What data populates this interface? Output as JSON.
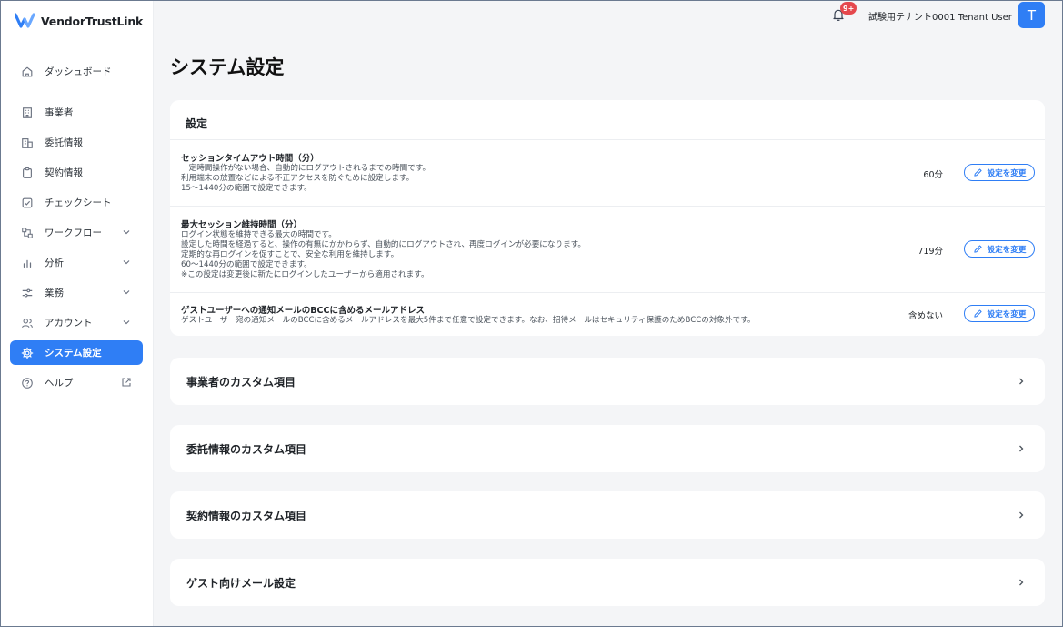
{
  "app": {
    "brand": "VendorTrustLink"
  },
  "sidebar": {
    "items": [
      {
        "label": "ダッシュボード",
        "icon": "home-icon"
      },
      {
        "label": "事業者",
        "icon": "building-icon"
      },
      {
        "label": "委託情報",
        "icon": "office-icon"
      },
      {
        "label": "契約情報",
        "icon": "clipboard-icon"
      },
      {
        "label": "チェックシート",
        "icon": "checkbox-icon"
      },
      {
        "label": "ワークフロー",
        "icon": "workflow-icon"
      },
      {
        "label": "分析",
        "icon": "bar-chart-icon"
      },
      {
        "label": "業務",
        "icon": "tasks-icon"
      },
      {
        "label": "アカウント",
        "icon": "users-icon"
      },
      {
        "label": "システム設定",
        "icon": "gear-icon"
      },
      {
        "label": "ヘルプ",
        "icon": "help-icon"
      }
    ]
  },
  "topbar": {
    "badge": "9+",
    "user_name": "試験用テナント0001 Tenant User",
    "avatar_letter": "T"
  },
  "page": {
    "title": "システム設定"
  },
  "settings": {
    "heading": "設定",
    "button_label": "設定を変更",
    "rows": [
      {
        "title": "セッションタイムアウト時間（分）",
        "desc": [
          "一定時間操作がない場合、自動的にログアウトされるまでの時間です。",
          "利用端末の放置などによる不正アクセスを防ぐために設定します。",
          "15〜1440分の範囲で設定できます。"
        ],
        "value": "60分"
      },
      {
        "title": "最大セッション維持時間（分）",
        "desc": [
          "ログイン状態を維持できる最大の時間です。",
          "設定した時間を経過すると、操作の有無にかかわらず、自動的にログアウトされ、再度ログインが必要になります。",
          "定期的な再ログインを促すことで、安全な利用を維持します。",
          "60〜1440分の範囲で設定できます。",
          "※この設定は変更後に新たにログインしたユーザーから適用されます。"
        ],
        "value": "719分"
      },
      {
        "title": "ゲストユーザーへの通知メールのBCCに含めるメールアドレス",
        "desc": [
          "ゲストユーザー宛の通知メールのBCCに含めるメールアドレスを最大5件まで任意で設定できます。なお、招待メールはセキュリティ保護のためBCCの対象外です。"
        ],
        "value": "含めない"
      }
    ]
  },
  "sections": [
    {
      "label": "事業者のカスタム項目"
    },
    {
      "label": "委託情報のカスタム項目"
    },
    {
      "label": "契約情報のカスタム項目"
    },
    {
      "label": "ゲスト向けメール設定"
    }
  ],
  "colors": {
    "accent": "#2f7ef5",
    "badge": "#e5484d",
    "background": "#f4f5f7"
  }
}
